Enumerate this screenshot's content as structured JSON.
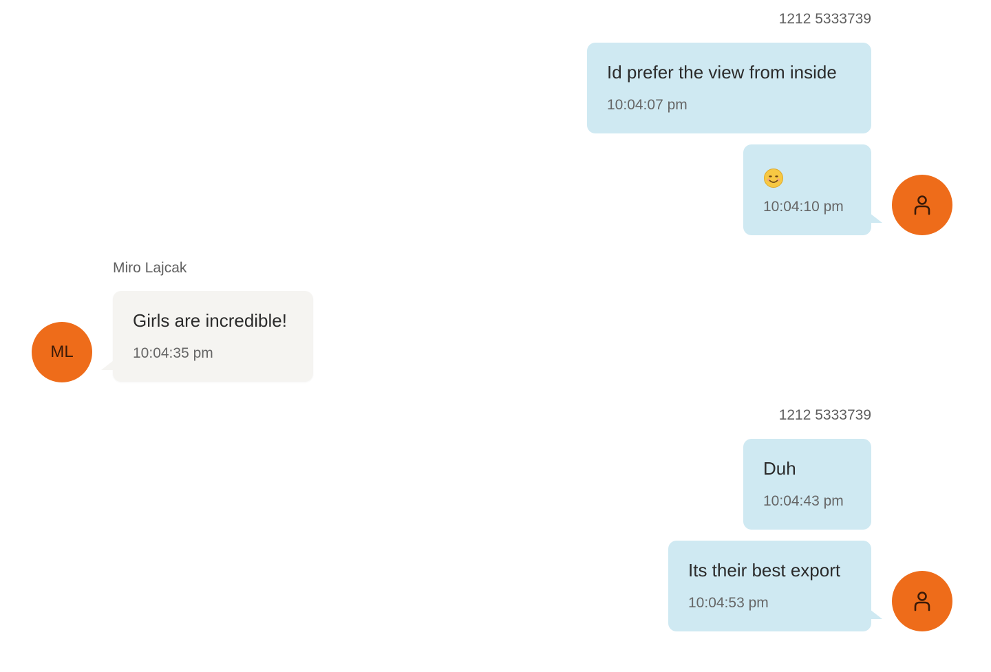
{
  "colors": {
    "outgoing_bubble": "#cfe9f2",
    "incoming_bubble": "#f5f4f1",
    "avatar": "#ee6c1a"
  },
  "groups": [
    {
      "sender": "1212 5333739",
      "direction": "outgoing",
      "avatar_icon": "user-icon",
      "messages": [
        {
          "text": "Id prefer the view from inside",
          "time": "10:04:07 pm"
        },
        {
          "text": "",
          "emoji": "smiling-face-emoji",
          "time": "10:04:10 pm"
        }
      ]
    },
    {
      "sender": "Miro Lajcak",
      "direction": "incoming",
      "avatar_initials": "ML",
      "messages": [
        {
          "text": "Girls are incredible!",
          "time": "10:04:35 pm"
        }
      ]
    },
    {
      "sender": "1212 5333739",
      "direction": "outgoing",
      "avatar_icon": "user-icon",
      "messages": [
        {
          "text": "Duh",
          "time": "10:04:43 pm"
        },
        {
          "text": "Its their best export",
          "time": "10:04:53 pm"
        }
      ]
    }
  ]
}
